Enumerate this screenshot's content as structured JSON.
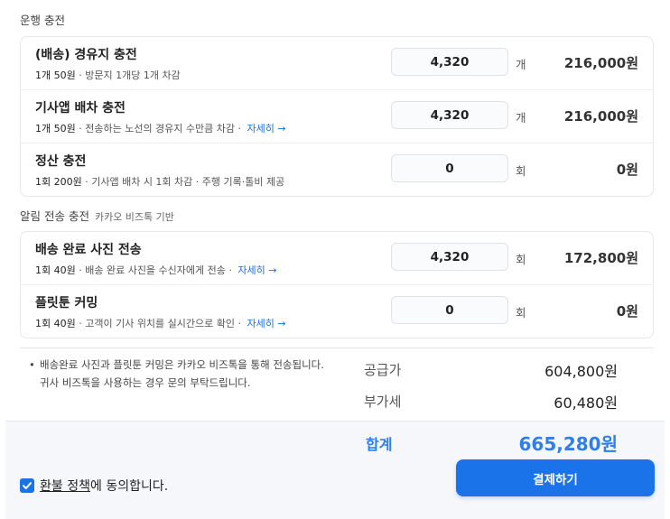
{
  "sections": {
    "delivery_title": "운행 충전",
    "alert_title": "알림 전송 충전",
    "alert_subtitle": "카카오 비즈톡 기반"
  },
  "delivery_items": [
    {
      "name": "(배송) 경유지 충전",
      "unit_price": "1개 50원",
      "desc": " · 방문지 1개당 1개 차감",
      "more": "",
      "quantity": "4,320",
      "unit": "개",
      "amount": "216,000원"
    },
    {
      "name": "기사앱 배차 충전",
      "unit_price": "1개 50원",
      "desc": " · 전송하는 노선의 경유지 수만큼 차감 · ",
      "more": "자세히 →",
      "quantity": "4,320",
      "unit": "개",
      "amount": "216,000원"
    },
    {
      "name": "정산 충전",
      "unit_price": "1회 200원",
      "desc": " · 기사앱 배차 시 1회 차감 · 주행 기록·톨비 제공",
      "more": "",
      "quantity": "0",
      "unit": "회",
      "amount": "0원"
    }
  ],
  "alert_items": [
    {
      "name": "배송 완료 사진 전송",
      "unit_price": "1회 40원",
      "desc": " · 배송 완료 사진을 수신자에게 전송 · ",
      "more": "자세히 →",
      "quantity": "4,320",
      "unit": "회",
      "amount": "172,800원"
    },
    {
      "name": "플릿툰 커밍",
      "unit_price": "1회 40원",
      "desc": " · 고객이 기사 위치를 실시간으로 확인 · ",
      "more": "자세히 →",
      "quantity": "0",
      "unit": "회",
      "amount": "0원"
    }
  ],
  "note": {
    "bullet": "•",
    "line1": "배송완료 사진과 플릿툰 커밍은 카카오 비즈톡을 통해 전송됩니다.",
    "line2": "귀사 비즈톡을 사용하는 경우 문의 부탁드립니다."
  },
  "summary": {
    "supply_label": "공급가",
    "supply_value": "604,800원",
    "vat_label": "부가세",
    "vat_value": "60,480원",
    "total_label": "합계",
    "total_value": "665,280원"
  },
  "agreement": {
    "checked": true,
    "policy_link": "환불 정책",
    "suffix": "에 동의합니다."
  },
  "pay_button": "결제하기",
  "colors": {
    "accent": "#1a73e8",
    "total_text": "#2f7fe8",
    "link": "#1a6fe8"
  }
}
